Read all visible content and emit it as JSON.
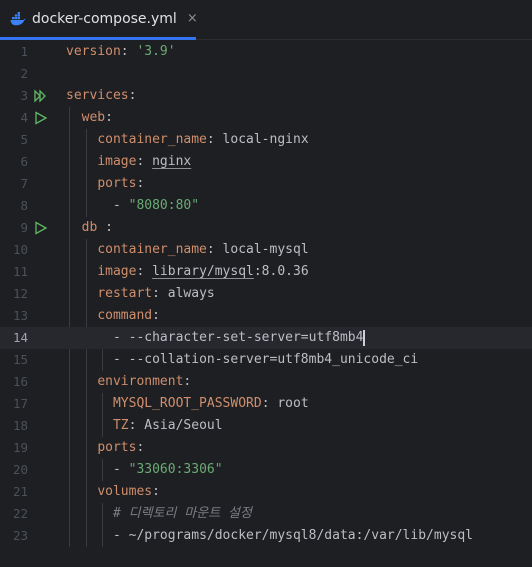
{
  "tab": {
    "filename": "docker-compose.yml",
    "close_glyph": "×",
    "icon": "docker-icon",
    "accent_color": "#3574f0"
  },
  "editor": {
    "current_line": 14,
    "lines": [
      {
        "n": "1"
      },
      {
        "n": "2"
      },
      {
        "n": "3"
      },
      {
        "n": "4"
      },
      {
        "n": "5"
      },
      {
        "n": "6"
      },
      {
        "n": "7"
      },
      {
        "n": "8"
      },
      {
        "n": "9"
      },
      {
        "n": "10"
      },
      {
        "n": "11"
      },
      {
        "n": "12"
      },
      {
        "n": "13"
      },
      {
        "n": "14"
      },
      {
        "n": "15"
      },
      {
        "n": "16"
      },
      {
        "n": "17"
      },
      {
        "n": "18"
      },
      {
        "n": "19"
      },
      {
        "n": "20"
      },
      {
        "n": "21"
      },
      {
        "n": "22"
      },
      {
        "n": "23"
      }
    ],
    "code": {
      "version_key": "version",
      "version_value": "'3.9'",
      "services_key": "services",
      "web_key": "web",
      "web_container_name_key": "container_name",
      "web_container_name_value": "local-nginx",
      "web_image_key": "image",
      "web_image_value": "nginx",
      "web_ports_key": "ports",
      "web_ports_item": "\"8080:80\"",
      "db_key": "db",
      "db_container_name_key": "container_name",
      "db_container_name_value": "local-mysql",
      "db_image_key": "image",
      "db_image_repo": "library/mysql",
      "db_image_tag": ":8.0.36",
      "db_restart_key": "restart",
      "db_restart_value": "always",
      "db_command_key": "command",
      "db_command_item_1": "--character-set-server=utf8mb4",
      "db_command_item_2": "--collation-server=utf8mb4_unicode_ci",
      "db_environment_key": "environment",
      "db_env_root_password_key": "MYSQL_ROOT_PASSWORD",
      "db_env_root_password_value": "root",
      "db_env_tz_key": "TZ",
      "db_env_tz_value": "Asia/Seoul",
      "db_ports_key": "ports",
      "db_ports_item": "\"33060:3306\"",
      "db_volumes_key": "volumes",
      "db_volumes_comment": "# 디렉토리 마운트 설정",
      "db_volumes_item": "~/programs/docker/mysql8/data:/var/lib/mysql"
    },
    "colors": {
      "background": "#1e1f22",
      "key": "#cf8e6d",
      "string": "#6aab73",
      "text": "#bcbec4",
      "comment": "#7a7e85",
      "line_number": "#4b5059",
      "run_gutter_icon": "#5fb865"
    }
  }
}
